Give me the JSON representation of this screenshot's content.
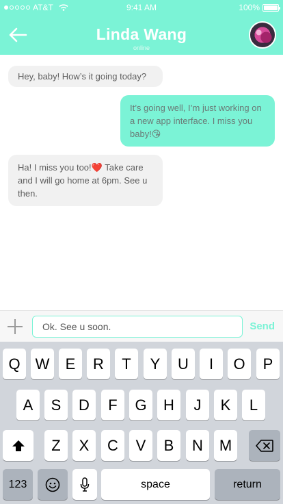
{
  "status_bar": {
    "carrier": "AT&T",
    "time": "9:41 AM",
    "battery": "100%"
  },
  "header": {
    "title": "Linda Wang",
    "subtitle": "online"
  },
  "messages": [
    {
      "direction": "in",
      "text": "Hey, baby! How’s it going today?"
    },
    {
      "direction": "out",
      "text": "It’s going well, I’m just working on a new app interface. I miss you baby!😘"
    },
    {
      "direction": "in",
      "text": "Ha! I miss you too!❤️ Take care and I will go home at 6pm. See u then."
    }
  ],
  "composer": {
    "input_value": "Ok. See u soon.",
    "send_label": "Send"
  },
  "keyboard": {
    "row1": [
      "Q",
      "W",
      "E",
      "R",
      "T",
      "Y",
      "U",
      "I",
      "O",
      "P"
    ],
    "row2": [
      "A",
      "S",
      "D",
      "F",
      "G",
      "H",
      "J",
      "K",
      "L"
    ],
    "row3": [
      "Z",
      "X",
      "C",
      "V",
      "B",
      "N",
      "M"
    ],
    "numbers_label": "123",
    "space_label": "space",
    "return_label": "return"
  },
  "colors": {
    "accent": "#7bf3d6",
    "incoming_bubble": "#f1f1f1",
    "keyboard_bg": "#d1d5db"
  }
}
